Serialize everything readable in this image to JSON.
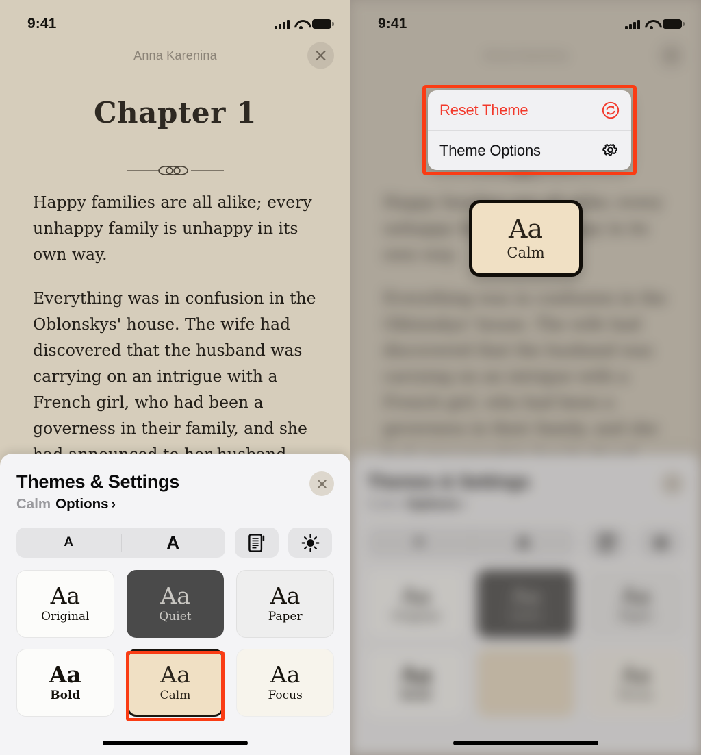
{
  "statusbar": {
    "time": "9:41",
    "signal_icon": "cellular-signal-icon",
    "wifi_icon": "wifi-icon",
    "battery_icon": "battery-icon"
  },
  "reader": {
    "book_title": "Anna Karenina",
    "close_icon": "close-icon",
    "chapter_title": "Chapter 1",
    "ornament_icon": "ornament-divider-icon",
    "paragraphs": [
      "Happy families are all alike; every unhappy family is unhappy in its own way.",
      "Everything was in confusion in the Oblonskys' house. The wife had discovered that the husband was carrying on an intrigue with a French girl, who had been a governess in their family, and she had announced to her husband that she could not go"
    ],
    "background_color": "#d6cdbb",
    "text_color": "#231f19"
  },
  "sheet": {
    "title": "Themes & Settings",
    "subtitle_theme": "Calm",
    "subtitle_options": "Options",
    "subtitle_chevron": "›",
    "close_icon": "close-icon",
    "controls": {
      "decrease_label": "A",
      "increase_label": "A",
      "page_view_icon": "page-layout-icon",
      "brightness_icon": "sun-brightness-icon"
    },
    "themes": [
      {
        "sample": "Aa",
        "name": "Original",
        "bg": "#fcfcfa",
        "fg": "#15120c",
        "selected": false
      },
      {
        "sample": "Aa",
        "name": "Quiet",
        "bg": "#4a4a4a",
        "fg": "#c9c7c2",
        "selected": false
      },
      {
        "sample": "Aa",
        "name": "Paper",
        "bg": "#eeeeee",
        "fg": "#15120c",
        "selected": false
      },
      {
        "sample": "Aa",
        "name": "Bold",
        "bg": "#fcfcfa",
        "fg": "#15120c",
        "selected": false
      },
      {
        "sample": "Aa",
        "name": "Calm",
        "bg": "#f0e0c4",
        "fg": "#2a241b",
        "selected": true
      },
      {
        "sample": "Aa",
        "name": "Focus",
        "bg": "#f7f4ec",
        "fg": "#15120c",
        "selected": false
      }
    ]
  },
  "context_menu": {
    "items": [
      {
        "label": "Reset Theme",
        "icon": "reset-circular-arrows-icon",
        "style": "danger"
      },
      {
        "label": "Theme Options",
        "icon": "gear-icon",
        "style": "normal"
      }
    ]
  },
  "floating_theme_card": {
    "sample": "Aa",
    "name": "Calm"
  },
  "annotation": {
    "color": "#fa3c14"
  },
  "home_indicator": "home-indicator"
}
